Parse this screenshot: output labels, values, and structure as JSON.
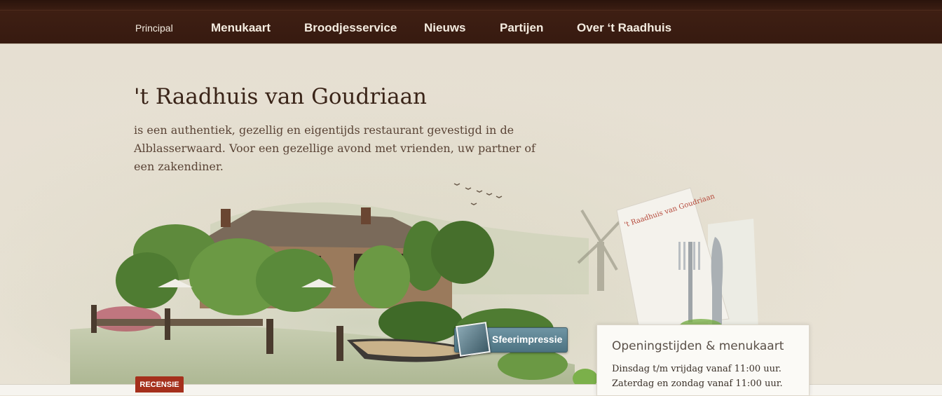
{
  "nav": {
    "items": [
      {
        "label": "Principal"
      },
      {
        "label": "Menukaart"
      },
      {
        "label": "Broodjesservice"
      },
      {
        "label": "Nieuws"
      },
      {
        "label": "Partijen"
      },
      {
        "label": "Over ‘t Raadhuis"
      }
    ]
  },
  "hero": {
    "title": "'t Raadhuis van Goudriaan",
    "intro": "is een authentiek, gezellig en eigentijds restaurant gevestigd in de Alblasserwaard. Voor een gezellige avond met vrienden, uw partner of een zakendiner.",
    "napkin_text": "'t Raadhuis van Goudriaan"
  },
  "sfeer": {
    "label": "Sfeerimpressie"
  },
  "hours": {
    "title": "Openingstijden & menukaart",
    "line1": "Dinsdag t/m vrijdag vanaf 11:00 uur.",
    "line2": "Zaterdag en zondag vanaf 11:00 uur."
  },
  "recensie": {
    "label": "RECENSIE"
  },
  "colors": {
    "nav_bg": "#3e1f13",
    "accent_red": "#a5301c",
    "button_blue": "#5a808f"
  }
}
